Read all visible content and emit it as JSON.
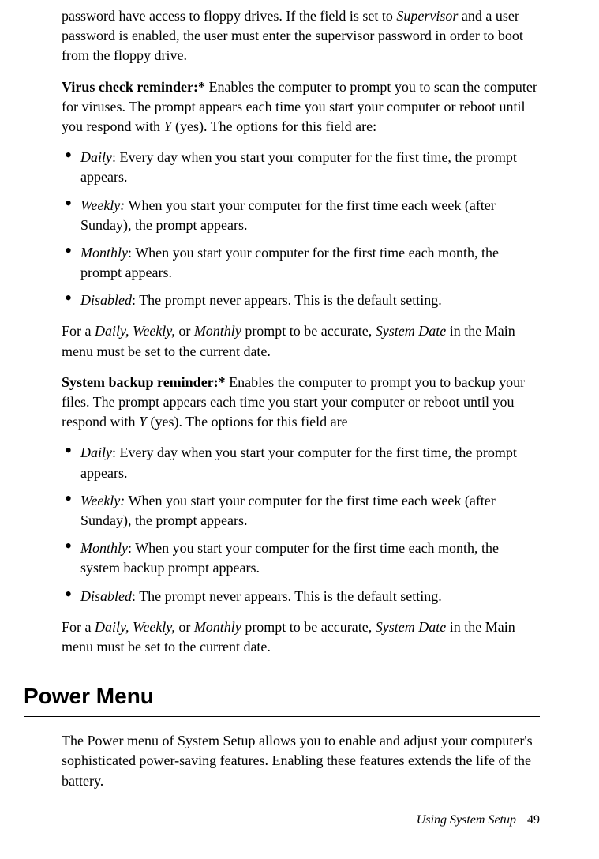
{
  "intro_para": {
    "pre": "password have access to floppy drives. If the field is set to ",
    "italic1": "Supervisor",
    "post": " and a user password is enabled, the user must enter the supervisor password in order to boot from the floppy drive."
  },
  "virus_check": {
    "label": "Virus check reminder:*",
    "desc_pre": " Enables the computer to prompt you to scan the computer for viruses. The prompt appears each time you start your computer or reboot until you respond with ",
    "desc_italic": "Y",
    "desc_post": " (yes). The options for this field are:"
  },
  "virus_list": [
    {
      "term": "Daily",
      "sep": ": ",
      "desc": "Every day when you start your computer for the first time, the prompt appears."
    },
    {
      "term": "Weekly:",
      "sep": " ",
      "desc": "When you start your computer for the first time each week (after Sunday), the prompt appears."
    },
    {
      "term": "Monthly",
      "sep": ": ",
      "desc": "When you start your computer for the first time each month, the prompt appears."
    },
    {
      "term": "Disabled",
      "sep": ": ",
      "desc": "The prompt never appears. This is the default setting."
    }
  ],
  "date_note1": {
    "pre": "For a ",
    "italic1": "Daily, Weekly,",
    "mid1": " or ",
    "italic2": "Monthly",
    "mid2": " prompt to be accurate, ",
    "italic3": "System Date",
    "post": " in the Main menu must be set to the current date."
  },
  "backup": {
    "label": "System backup reminder:*",
    "desc_pre": " Enables the computer to prompt you to backup your files. The prompt appears each time you start your computer or reboot until you respond with ",
    "desc_italic": "Y",
    "desc_post": " (yes). The options for this field are"
  },
  "backup_list": [
    {
      "term": "Daily",
      "sep": ": ",
      "desc": "Every day when you start your computer for the first time, the prompt appears."
    },
    {
      "term": "Weekly:",
      "sep": " ",
      "desc": "When you start your computer for the first time each week (after Sunday), the prompt appears."
    },
    {
      "term": "Monthly",
      "sep": ": ",
      "desc": "When you start your computer for the first time each month, the system backup prompt appears."
    },
    {
      "term": "Disabled",
      "sep": ": ",
      "desc": "The prompt never appears. This is the default setting."
    }
  ],
  "date_note2": {
    "pre": "For a ",
    "italic1": "Daily, Weekly,",
    "mid1": " or ",
    "italic2": "Monthly",
    "mid2": " prompt to be accurate, ",
    "italic3": "System Date",
    "post": " in the Main menu must be set to the current date."
  },
  "power_menu": {
    "heading": "Power Menu",
    "para": "The Power menu of System Setup allows you to enable and adjust your computer's sophisticated power-saving features. Enabling these features extends the life of the battery."
  },
  "footer": {
    "title": "Using System Setup",
    "page": "49"
  }
}
